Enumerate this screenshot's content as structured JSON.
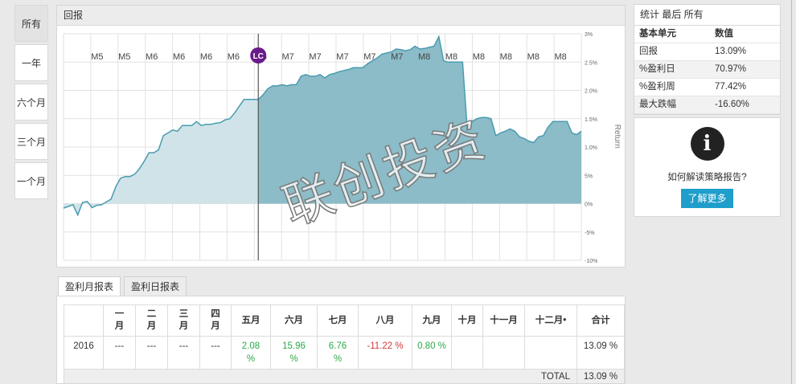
{
  "nav": {
    "items": [
      "所有",
      "一年",
      "六个月",
      "三个月",
      "一个月"
    ],
    "active": 0
  },
  "chart": {
    "title": "回报",
    "marker_label": "LC",
    "axis_label": "Return",
    "colors": {
      "area": "#8bbcc8",
      "line": "#4a9bb0",
      "pre_area": "#cfe3e8"
    },
    "chart_data": {
      "type": "area",
      "x_tick_labels": [
        "M5",
        "M5",
        "M6",
        "M6",
        "M6",
        "M6",
        "M6",
        "M7",
        "M7",
        "M7",
        "M7",
        "M7",
        "M8",
        "M8",
        "M8",
        "M8",
        "M8",
        "M8"
      ],
      "y_ticks": [
        3.0,
        2.5,
        2.0,
        1.5,
        1.0,
        0.5,
        0.0,
        -0.5,
        -1.0
      ],
      "y_tick_labels": [
        "3%",
        "2.5%",
        "2.0%",
        "1.5%",
        "1.0%",
        "5%",
        "0%",
        "-5%",
        "-10%"
      ],
      "ylim": [
        -1.0,
        3.0
      ],
      "grid": true,
      "values": [
        -0.08,
        -0.05,
        -0.02,
        -0.2,
        0.02,
        0.04,
        -0.07,
        -0.03,
        -0.02,
        0.03,
        0.08,
        0.3,
        0.45,
        0.48,
        0.48,
        0.52,
        0.62,
        0.75,
        0.9,
        0.9,
        0.95,
        1.2,
        1.25,
        1.3,
        1.28,
        1.38,
        1.38,
        1.38,
        1.45,
        1.38,
        1.4,
        1.4,
        1.42,
        1.43,
        1.48,
        1.5,
        1.6,
        1.72,
        1.84,
        1.84,
        1.84,
        1.84,
        1.92,
        2.03,
        2.08,
        2.08,
        2.1,
        2.08,
        2.1,
        2.1,
        2.25,
        2.28,
        2.25,
        2.25,
        2.28,
        2.22,
        2.28,
        2.3,
        2.33,
        2.35,
        2.37,
        2.4,
        2.4,
        2.4,
        2.47,
        2.52,
        2.57,
        2.64,
        2.66,
        2.68,
        2.73,
        2.72,
        2.7,
        2.72,
        2.78,
        2.73,
        2.74,
        2.76,
        2.78,
        2.95,
        2.52,
        2.5,
        2.5,
        2.5,
        2.5,
        1.3,
        1.45,
        1.5,
        1.52,
        1.52,
        1.5,
        1.2,
        1.25,
        1.28,
        1.32,
        1.28,
        1.18,
        1.15,
        1.1,
        1.08,
        1.18,
        1.2,
        1.35,
        1.45,
        1.45,
        1.45,
        1.45,
        1.25,
        1.22,
        1.28
      ],
      "marker_index": 41
    }
  },
  "stats": {
    "title": "统计 最后 所有",
    "col_key": "基本单元",
    "col_val": "数值",
    "rows": [
      {
        "k": "回报",
        "v": "13.09%"
      },
      {
        "k": "%盈利日",
        "v": "70.97%"
      },
      {
        "k": "%盈利周",
        "v": "77.42%"
      },
      {
        "k": "最大跌幅",
        "v": "-16.60%"
      }
    ]
  },
  "info": {
    "icon": "info-icon",
    "text": "如何解读策略报告?",
    "button": "了解更多"
  },
  "tabs": [
    "盈利月报表",
    "盈利日报表"
  ],
  "watermark": "联创投资",
  "monthly": {
    "headers": [
      "",
      "一\n月",
      "二\n月",
      "三\n月",
      "四\n月",
      "五月",
      "六月",
      "七月",
      "八月",
      "九月",
      "十月",
      "十一月",
      "十二月•",
      "合计"
    ],
    "row": [
      "2016",
      "---",
      "---",
      "---",
      "---",
      "2.08\n%",
      "15.96\n%",
      "6.76\n%",
      "-11.22 %",
      "0.80 %",
      "",
      "",
      "",
      "13.09 %"
    ],
    "total_label": "TOTAL",
    "total_value": "13.09 %"
  }
}
